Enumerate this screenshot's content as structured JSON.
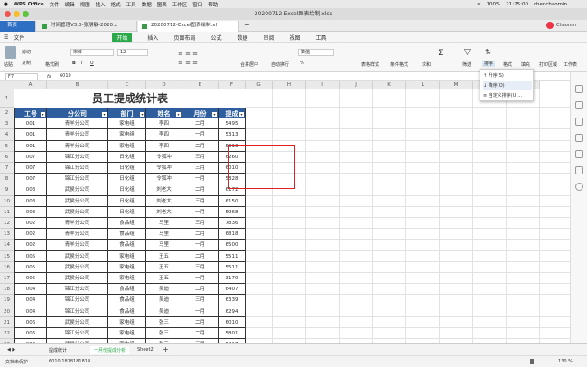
{
  "menubar": {
    "apple": "",
    "app": "WPS Office",
    "items": [
      "文件",
      "编辑",
      "视图",
      "插入",
      "格式",
      "工具",
      "数据",
      "图表",
      "工作区",
      "窗口",
      "帮助"
    ],
    "time": "21:25:00",
    "user": "chenchaomin",
    "battery": "100%"
  },
  "window": {
    "title": "20200712-Excel图表绘制.xlsx"
  },
  "filetabs": {
    "home": "首页",
    "tab1": "时间管理V3.0-张朋敏-2020.x",
    "tab2": "20200712-Excel图表绘制.xl",
    "add": "+",
    "user": "Chaomin"
  },
  "ribbon": {
    "file": "文件",
    "start": "开始",
    "tabs": [
      "插入",
      "页面布局",
      "公式",
      "数据",
      "审阅",
      "视图",
      "工具"
    ]
  },
  "toolbar": {
    "paste": "粘贴",
    "cut": "剪切",
    "copy": "复制",
    "format_painter": "格式刷",
    "font": "宋体",
    "size": "12",
    "merge": "合并居中",
    "wrap": "自动换行",
    "number_format": "数值",
    "percent": "%",
    "table_style": "表格样式",
    "cond_format": "条件格式",
    "sum": "求和",
    "filter": "筛选",
    "sort": "排序",
    "format": "格式",
    "fill": "填充",
    "print": "打印区域",
    "insert": "添加",
    "ops": "工作表",
    "bold": "B",
    "italic": "I",
    "underline": "U"
  },
  "formula": {
    "cell_ref": "F7",
    "fx": "fx",
    "value": "6010"
  },
  "sort_menu": {
    "items": [
      "升序(S)",
      "降序(O)",
      "自定义排序(U)..."
    ]
  },
  "columns": [
    "A",
    "B",
    "C",
    "D",
    "E",
    "F",
    "G",
    "H",
    "I",
    "J",
    "K",
    "L",
    "M",
    "N",
    "O"
  ],
  "sheet": {
    "title": "员工提成统计表",
    "headers": [
      "工号",
      "分公司",
      "部门",
      "姓名",
      "月份",
      "提成"
    ],
    "rows": [
      [
        "001",
        "青羊分公司",
        "家电组",
        "李四",
        "二月",
        "5495"
      ],
      [
        "001",
        "青羊分公司",
        "家电组",
        "李四",
        "一月",
        "5313"
      ],
      [
        "001",
        "青羊分公司",
        "家电组",
        "李四",
        "二月",
        "5313"
      ],
      [
        "007",
        "锦江分公司",
        "日化组",
        "令狐冲",
        "三月",
        "6260"
      ],
      [
        "007",
        "锦江分公司",
        "日化组",
        "令狐冲",
        "三月",
        "6010"
      ],
      [
        "007",
        "锦江分公司",
        "日化组",
        "令狐冲",
        "一月",
        "5828"
      ],
      [
        "003",
        "武侯分公司",
        "日化组",
        "刘老大",
        "二月",
        "6172"
      ],
      [
        "003",
        "武侯分公司",
        "日化组",
        "刘老大",
        "三月",
        "6150"
      ],
      [
        "003",
        "武侯分公司",
        "日化组",
        "刘老大",
        "一月",
        "5968"
      ],
      [
        "002",
        "青羊分公司",
        "食品组",
        "马里",
        "三月",
        "7836"
      ],
      [
        "002",
        "青羊分公司",
        "食品组",
        "马里",
        "二月",
        "6818"
      ],
      [
        "002",
        "青羊分公司",
        "食品组",
        "马里",
        "一月",
        "6500"
      ],
      [
        "005",
        "武侯分公司",
        "家电组",
        "王五",
        "二月",
        "5511"
      ],
      [
        "005",
        "武侯分公司",
        "家电组",
        "王五",
        "三月",
        "5511"
      ],
      [
        "005",
        "武侯分公司",
        "家电组",
        "王五",
        "一月",
        "3170"
      ],
      [
        "004",
        "锦江分公司",
        "食品组",
        "吴迪",
        "二月",
        "6407"
      ],
      [
        "004",
        "锦江分公司",
        "食品组",
        "吴迪",
        "三月",
        "6339"
      ],
      [
        "004",
        "锦江分公司",
        "食品组",
        "吴迪",
        "一月",
        "6294"
      ],
      [
        "006",
        "武侯分公司",
        "家电组",
        "张三",
        "二月",
        "6010"
      ],
      [
        "006",
        "锦江分公司",
        "家电组",
        "张三",
        "二月",
        "5801"
      ],
      [
        "006",
        "武侯分公司",
        "家电组",
        "张三",
        "三月",
        "5417"
      ]
    ]
  },
  "sheettabs": {
    "tabs": [
      "提成统计",
      "一月份提成分析",
      "Sheet2"
    ],
    "add": "+"
  },
  "status": {
    "protect": "文档未保护",
    "value": "6010.1818181818",
    "zoom": "130 %"
  },
  "colors": {
    "header_blue": "#2e5e9e",
    "start_green": "#2aa84a",
    "highlight": "#e02020"
  }
}
